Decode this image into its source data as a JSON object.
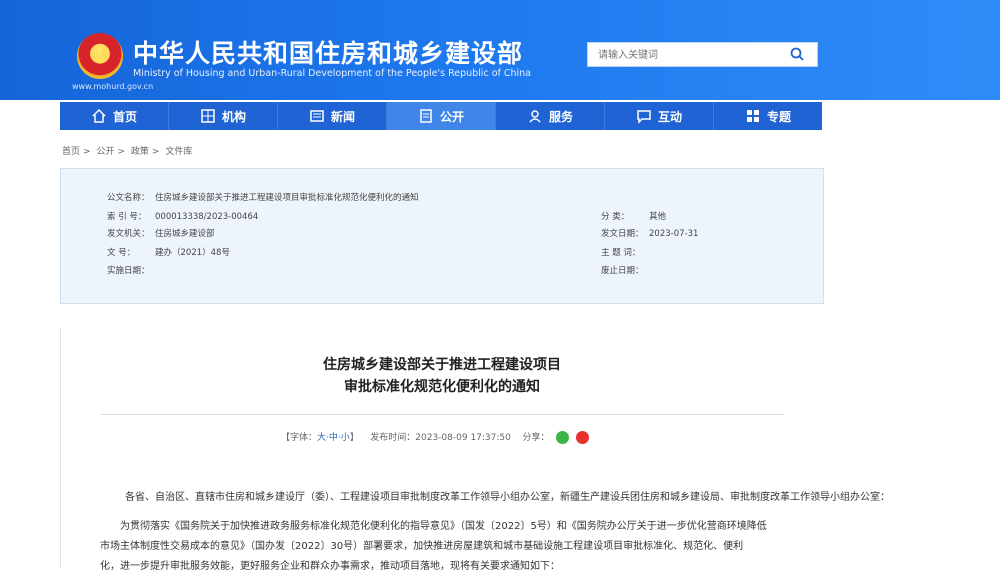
{
  "header": {
    "top_links": [
      "",
      "",
      ""
    ],
    "top_right": [
      "",
      ""
    ],
    "site_title": "中华人民共和国住房和城乡建设部",
    "site_subtitle": "Ministry of Housing and Urban-Rural Development of the People's Republic of China",
    "site_url": "www.mohurd.gov.cn",
    "search_placeholder": "请输入关键词",
    "colors": {
      "header": "#1e78ee",
      "nav": "#1f63d4",
      "nav_active": "#3f86e8"
    }
  },
  "nav": [
    {
      "label": "首页",
      "icon": "home-icon"
    },
    {
      "label": "机构",
      "icon": "org-icon"
    },
    {
      "label": "新闻",
      "icon": "news-icon"
    },
    {
      "label": "公开",
      "icon": "public-icon",
      "active": true
    },
    {
      "label": "服务",
      "icon": "service-icon"
    },
    {
      "label": "互动",
      "icon": "interact-icon"
    },
    {
      "label": "专题",
      "icon": "topic-icon"
    }
  ],
  "breadcrumb": [
    "首页",
    "公开",
    "政策",
    "文件库"
  ],
  "info": {
    "title_label": "公文名称：",
    "title_value": "住房城乡建设部关于推进工程建设项目审批标准化规范化便利化的通知",
    "index_label": "索 引 号：",
    "index_value": "000013338/2023-00464",
    "issuer_label": "发文机关：",
    "issuer_value": "住房城乡建设部",
    "docno_label": "文    号：",
    "docno_value": "建办（2021）48号",
    "effective_label": "实施日期：",
    "effective_value": "",
    "category_label": "分    类：",
    "category_value": "其他",
    "date_label": "发文日期：",
    "date_value": "2023-07-31",
    "subject_label": "主 题 词：",
    "subject_value": "",
    "expire_label": "废止日期：",
    "expire_value": ""
  },
  "article": {
    "title_line1": "住房城乡建设部关于推进工程建设项目",
    "title_line2": "审批标准化规范化便利化的通知",
    "font_label": "【字体：",
    "font_large": "大",
    "font_mid": "中",
    "font_small": "小",
    "font_end": "】",
    "publish_time": "发布时间：2023-08-09 17:37:50",
    "share_label": "分享：",
    "para1": "各省、自治区、直辖市住房和城乡建设厅（委）、工程建设项目审批制度改革工作领导小组办公室，新疆生产建设兵团住房和城乡建设局、审批制度改革工作领导小组办公室：",
    "para2a": "为贯彻落实《国务院关于加快推进政务服务标准化规范化便利化的指导意见》（国发〔2022〕5号）和《国务院办公厅关于进一步优化营商环境降低",
    "para2b": "市场主体制度性交易成本的意见》（国办发〔2022〕30号）部署要求，加快推进房屋建筑和城市基础设施工程建设项目审批标准化、规范化、便利",
    "para2c": "化，进一步提升审批服务效能，更好服务企业和群众办事需求，推动项目落地，现将有关要求通知如下："
  }
}
